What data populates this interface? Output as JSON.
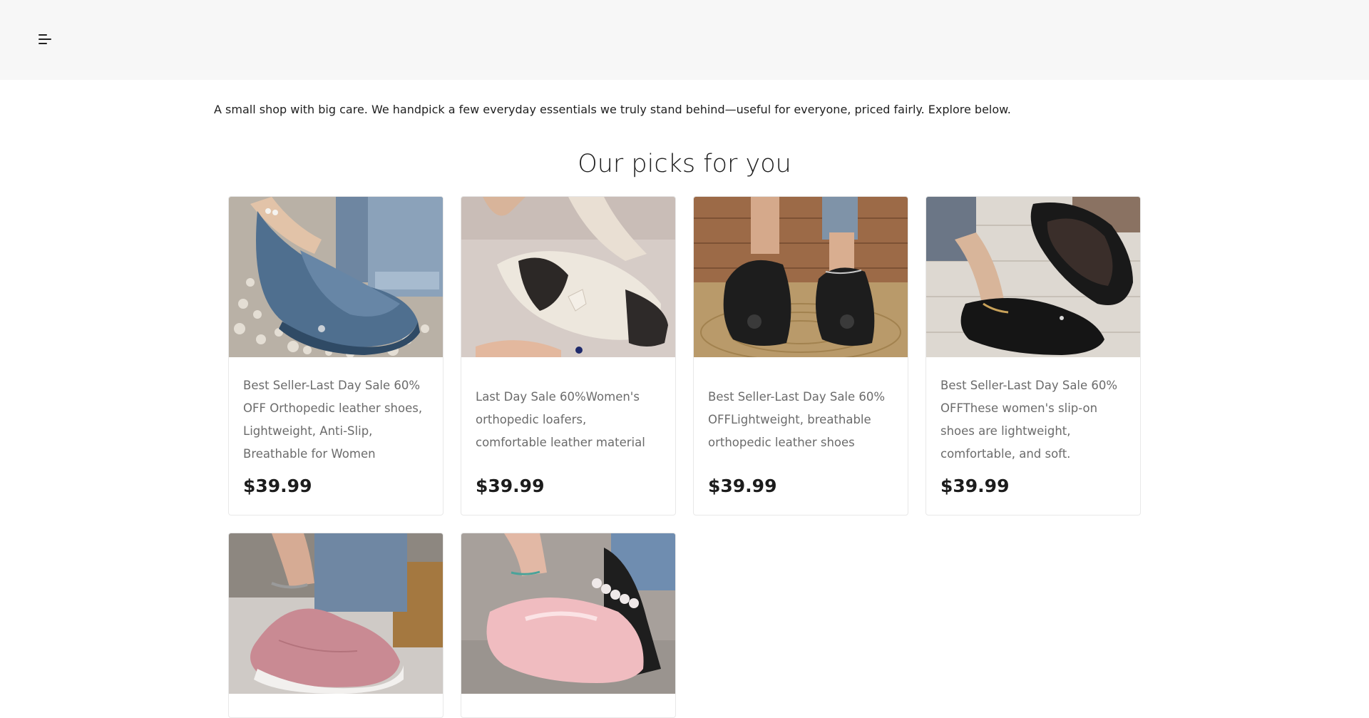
{
  "header": {
    "menu_icon": "hamburger-menu-icon"
  },
  "intro": "A small shop with big care. We handpick a few everyday essentials we truly stand behind—useful for everyone, priced fairly. Explore below.",
  "section_title": "Our picks for you",
  "products": [
    {
      "title": "Best Seller-Last Day Sale 60% OFF Orthopedic leather shoes, Lightweight, Anti-Slip, Breathable for Women",
      "price": "$39.99"
    },
    {
      "title": "Last Day Sale 60%Women's orthopedic loafers, comfortable leather material",
      "price": "$39.99"
    },
    {
      "title": "Best Seller-Last Day Sale 60% OFFLightweight, breathable orthopedic leather shoes",
      "price": "$39.99"
    },
    {
      "title": "Best Seller-Last Day Sale 60% OFFThese women's slip-on shoes are lightweight, comfortable, and soft.",
      "price": "$39.99"
    },
    {
      "title": "",
      "price": ""
    },
    {
      "title": "",
      "price": ""
    }
  ]
}
